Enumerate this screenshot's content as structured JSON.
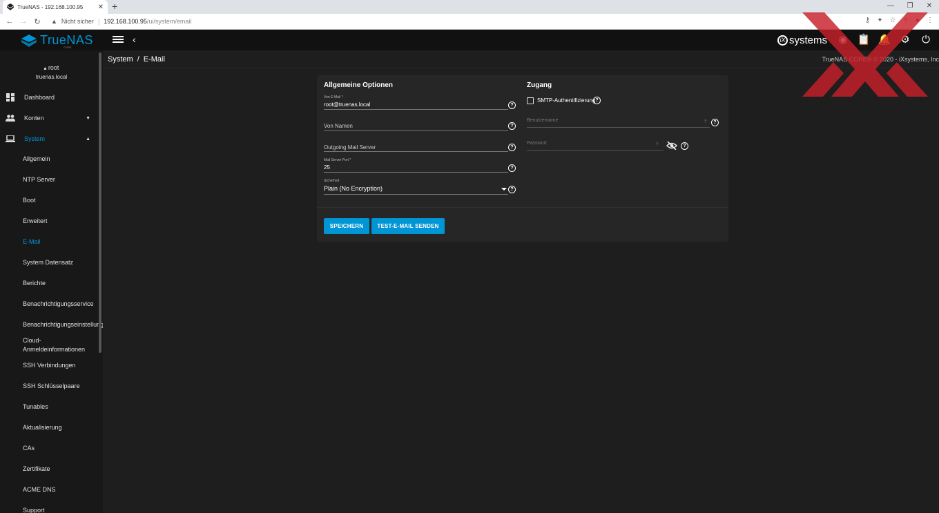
{
  "browser": {
    "tab_title": "TrueNAS - 192.168.100.95",
    "tab_close": "✕",
    "new_tab": "+",
    "security_label": "Nicht sicher",
    "url_host": "192.168.100.95",
    "url_path": "/ui/system/email"
  },
  "header": {
    "brand": "TrueNAS",
    "brand_sub": "CORE",
    "ix_brand": "systems",
    "ix_letter": "iX"
  },
  "sidebar": {
    "user": "root",
    "hostname": "truenas.local",
    "main_items": [
      {
        "label": "Dashboard",
        "icon": "dashboard-icon"
      },
      {
        "label": "Konten",
        "icon": "people-icon"
      },
      {
        "label": "System",
        "icon": "laptop-icon"
      }
    ],
    "sub_items": [
      "Allgemein",
      "NTP Server",
      "Boot",
      "Erweitert",
      "E-Mail",
      "System Datensatz",
      "Berichte",
      "Benachrichtigungsservice",
      "Benachrichtigungseinstellungen",
      "Cloud-",
      "Anmeldeinformationen",
      "SSH Verbindungen",
      "SSH Schlüsselpaare",
      "Tunables",
      "Aktualisierung",
      "CAs",
      "Zertifikate",
      "ACME DNS",
      "Support"
    ],
    "active_sub": "E-Mail",
    "active_color": "#0095d5"
  },
  "breadcrumb": {
    "parent": "System",
    "separator": "/",
    "current": "E-Mail"
  },
  "copyright": "TrueNAS CORE® © 2020 - iXsystems, Inc",
  "form": {
    "general_title": "Allgemeine Optionen",
    "access_title": "Zugang",
    "from_email_label": "Von E-Mail *",
    "from_email_value": "root@truenas.local",
    "from_name_placeholder": "Von Namen",
    "outgoing_server_placeholder": "Outgoing Mail Server",
    "port_label": "Mail Server Port *",
    "port_value": "25",
    "security_label": "Sicherheit",
    "security_value": "Plain (No Encryption)",
    "smtp_auth_label": "SMTP-Authentifizierung",
    "username_placeholder": "Benutzername",
    "password_placeholder": "Passwort",
    "help_glyph": "?",
    "save_button": "SPEICHERN",
    "test_button": "TEST-E-MAIL SENDEN"
  },
  "colors": {
    "accent": "#0095d5",
    "background": "#1e1e1e",
    "card": "#262626",
    "header": "#111111"
  }
}
